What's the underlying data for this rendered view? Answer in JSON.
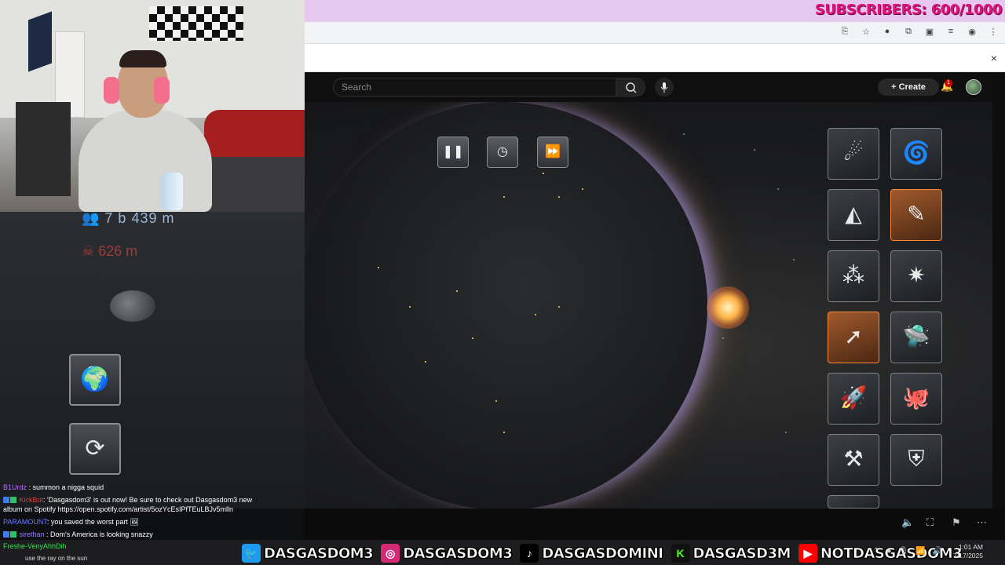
{
  "stream": {
    "subscribers_label": "SUBSCRIBERS: 600/1000"
  },
  "browser": {
    "close_label": "×",
    "addr_icons": [
      "⎘",
      "☆",
      "●",
      "⧉",
      "▣",
      "≡",
      "◉",
      "⋮"
    ]
  },
  "youtube": {
    "search_placeholder": "Search",
    "create_label": "Create",
    "notification_count": "1"
  },
  "game": {
    "population": "7 b 439 m",
    "deaths": "626 m",
    "time_controls": [
      "pause",
      "speed-clock",
      "fast-forward"
    ],
    "left_buttons": [
      "earth-view",
      "reset"
    ],
    "weapons": [
      {
        "name": "meteors",
        "icon": "☄",
        "selected": false
      },
      {
        "name": "black-hole",
        "icon": "🌀",
        "selected": false
      },
      {
        "name": "shield-dome",
        "icon": "◭",
        "selected": false
      },
      {
        "name": "laser-beam",
        "icon": "✎",
        "selected": true
      },
      {
        "name": "missile-array",
        "icon": "⁂",
        "selected": false
      },
      {
        "name": "freeze-blast",
        "icon": "✷",
        "selected": false
      },
      {
        "name": "rocket",
        "icon": "➚",
        "selected": true
      },
      {
        "name": "ufo",
        "icon": "☄",
        "selected": false
      },
      {
        "name": "nuke-rocket",
        "icon": "🚀",
        "selected": false
      },
      {
        "name": "octopus",
        "icon": "🐙",
        "selected": false
      },
      {
        "name": "drill-missile",
        "icon": "⚒",
        "selected": false
      },
      {
        "name": "defense-shield",
        "icon": "⛨",
        "selected": false
      }
    ]
  },
  "chat": [
    {
      "user": "B1Urdz",
      "text": " : summon a nigga squid",
      "color": "#b96ef5"
    },
    {
      "user": "KickBot",
      "text": ": 'Dasgasdom3' is out now! Be sure to check out Dasgasdom3 new",
      "color": "#e33d3d"
    },
    {
      "user": "",
      "text": "album on Spotify https://open.spotify.com/artist/5ozYcEsIPfTEuLBJv5mlln",
      "color": "#ffffff"
    },
    {
      "user": "PARAMOUNT",
      "text": ": you saved the worst part",
      "color": "#6a7bff"
    },
    {
      "user": "sirethan",
      "text": " : Dom's America is looking snazzy",
      "color": "#9a7bff"
    }
  ],
  "gifter": {
    "name": "Freshe-VenyAhhDih",
    "message": "use the ray on the sun"
  },
  "socials": [
    {
      "icon": "twitter",
      "glyph": "🐦",
      "handle": "DASGASDOM3"
    },
    {
      "icon": "instagram",
      "glyph": "◎",
      "handle": "DASGASDOM3"
    },
    {
      "icon": "tiktok",
      "glyph": "♪",
      "handle": "DASGASDOMINI"
    },
    {
      "icon": "kick",
      "glyph": "K",
      "handle": "DASGASD3M"
    },
    {
      "icon": "youtube",
      "glyph": "▶",
      "handle": "NOTDASGASDOM3"
    }
  ],
  "clock": {
    "time": "1:01 AM",
    "date": "7/17/2025"
  },
  "player_controls": [
    "volume",
    "fullscreen",
    "bookmark",
    "more"
  ]
}
